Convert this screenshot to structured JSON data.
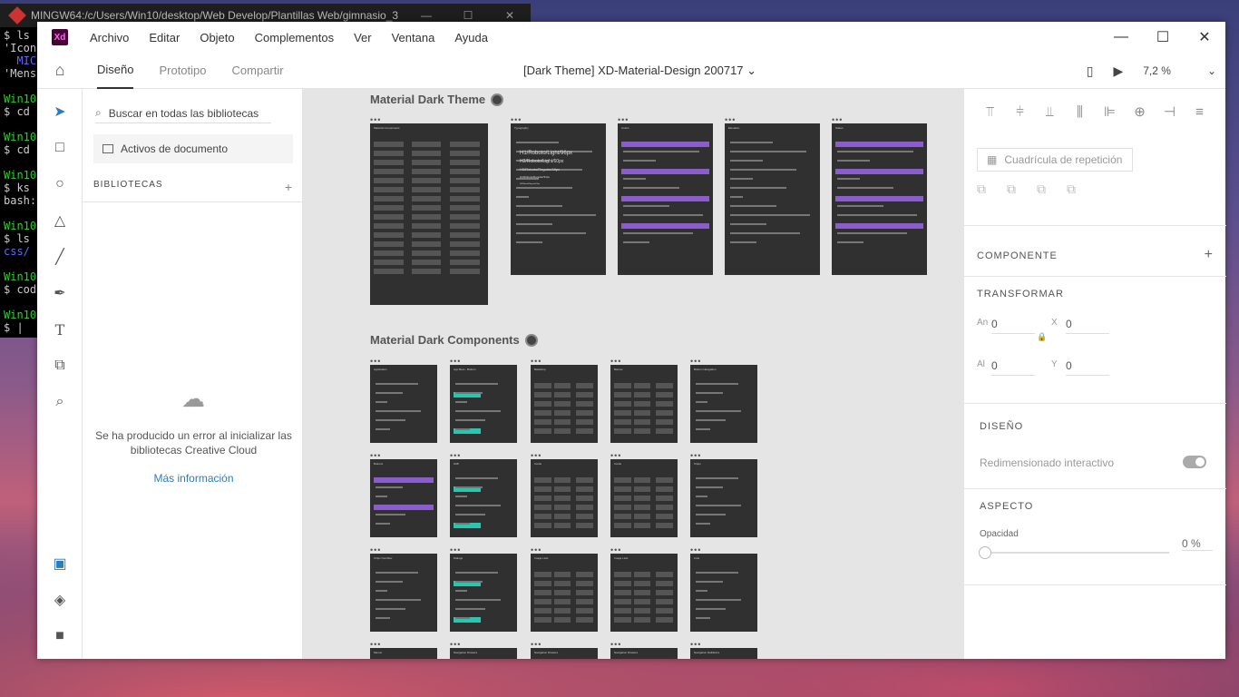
{
  "terminal": {
    "title": "MINGW64:/c/Users/Win10/desktop/Web Develop/Plantillas Web/gimnasio_3",
    "lines": [
      "$ ls",
      "'Icon",
      "  MICR",
      "'Mens",
      "",
      "Win10",
      "$ cd",
      "",
      "Win10",
      "$ cd",
      "",
      "Win10",
      "$ ks",
      "bash:",
      "",
      "Win10",
      "$ ls",
      "css/",
      "",
      "Win10",
      "$ cod",
      "",
      "Win10",
      "$ |"
    ]
  },
  "app": {
    "logo": "Xd",
    "menu": [
      "Archivo",
      "Editar",
      "Objeto",
      "Complementos",
      "Ver",
      "Ventana",
      "Ayuda"
    ],
    "window_controls": [
      "—",
      "☐",
      "✕"
    ]
  },
  "topbar": {
    "tabs": [
      "Diseño",
      "Prototipo",
      "Compartir"
    ],
    "doc_title": "[Dark Theme] XD-Material-Design 200717",
    "zoom": "7,2 %"
  },
  "libraries": {
    "search_placeholder": "Buscar en todas las bibliotecas",
    "doc_assets": "Activos de documento",
    "section": "BIBLIOTECAS",
    "error": "Se ha producido un error al inicializar las bibliotecas Creative Cloud",
    "more_info": "Más información"
  },
  "canvas": {
    "group1_title": "Material Dark Theme",
    "group2_title": "Material Dark Components",
    "group1_boards": [
      "Material Components",
      "Typography",
      "Colors",
      "Elevation",
      "States"
    ],
    "group1_type_samples": [
      "H1/Roboto/Light/96px",
      "H2/Roboto/Light/60px",
      "H3/Roboto/Regular/48px",
      "H4/Roboto/Regular/34px",
      "H5/Roboto/Regular/24px"
    ],
    "group2_rows": [
      [
        "Application",
        "App Bars - Bottom",
        "Backdrop",
        "Banner",
        "Bottom Navigation"
      ],
      [
        "Buttons",
        "FAB",
        "Cards",
        "Cards",
        "Chips"
      ],
      [
        "Chips Overflow",
        "Dialogs",
        "Image Lists",
        "Image Lists",
        "Lists"
      ],
      [
        "Menus",
        "Navigation Drawers",
        "Navigation Drawers",
        "Navigation Drawers",
        "Navigation Rail/Extra"
      ]
    ]
  },
  "props": {
    "repeat_grid": "Cuadrícula de repetición",
    "component": "COMPONENTE",
    "transform": "TRANSFORMAR",
    "w_label": "An",
    "w_value": "0",
    "x_label": "X",
    "x_value": "0",
    "h_label": "Al",
    "h_value": "0",
    "y_label": "Y",
    "y_value": "0",
    "layout": "DISEÑO",
    "responsive": "Redimensionado interactivo",
    "appearance": "ASPECTO",
    "opacity_label": "Opacidad",
    "opacity_value": "0 %"
  }
}
